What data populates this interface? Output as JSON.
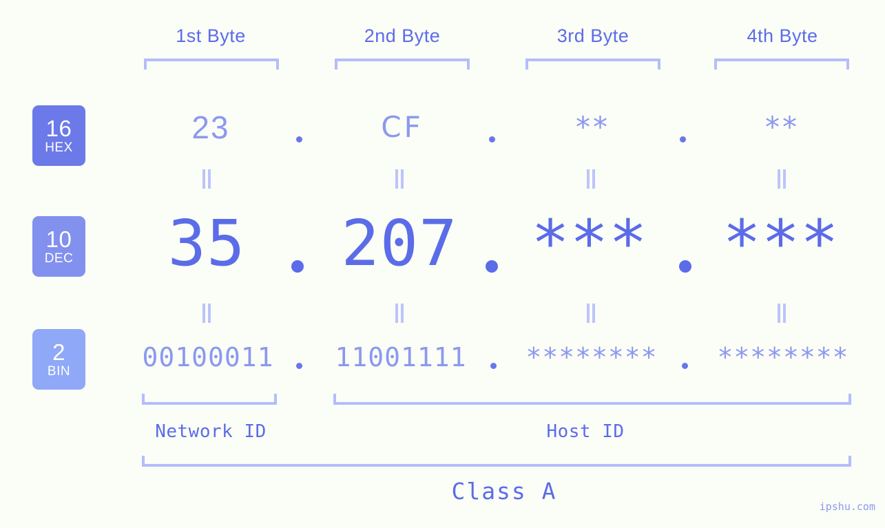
{
  "background_color": "#fbfdf7",
  "accent_color": "#5b6ce8",
  "accent_light_color": "#8b99ee",
  "bracket_color": "#b4bdfb",
  "header": {
    "bytes": [
      {
        "label": "1st Byte"
      },
      {
        "label": "2nd Byte"
      },
      {
        "label": "3rd Byte"
      },
      {
        "label": "4th Byte"
      }
    ]
  },
  "bases": [
    {
      "num": "16",
      "label": "HEX",
      "color": "#6b7ae8"
    },
    {
      "num": "10",
      "label": "DEC",
      "color": "#8290ee"
    },
    {
      "num": "2",
      "label": "BIN",
      "color": "#8fa8f7"
    }
  ],
  "rows": {
    "hex": {
      "values": [
        "23",
        "CF",
        "**",
        "**"
      ],
      "separators": [
        ".",
        ".",
        "."
      ]
    },
    "dec": {
      "values": [
        "35",
        "207",
        "***",
        "***"
      ],
      "separators": [
        ".",
        ".",
        "."
      ]
    },
    "bin": {
      "values": [
        "00100011",
        "11001111",
        "********",
        "********"
      ],
      "separators": [
        ".",
        ".",
        "."
      ]
    }
  },
  "equals_marks": [
    "=",
    "=",
    "=",
    "=",
    "=",
    "=",
    "=",
    "="
  ],
  "footer": {
    "network_id_label": "Network ID",
    "host_id_label": "Host ID",
    "class_label": "Class A"
  },
  "watermark": "ipshu.com"
}
